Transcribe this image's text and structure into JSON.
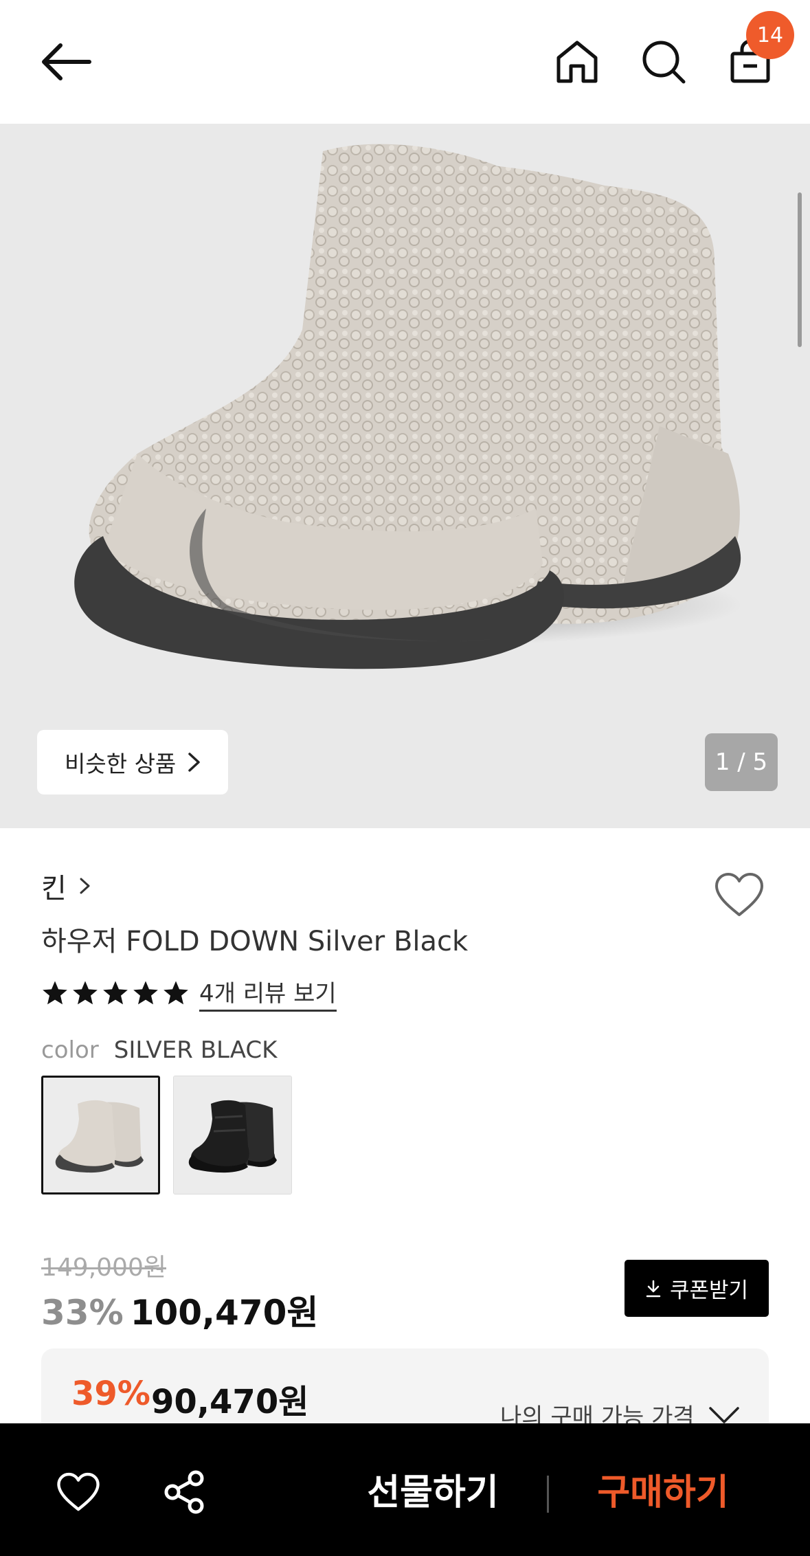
{
  "header": {
    "back_icon": "arrow-left-icon",
    "home_icon": "home-icon",
    "search_icon": "search-icon",
    "bag_icon": "shopping-bag-icon",
    "cart_count": "14",
    "badge_color": "#ef5b2b"
  },
  "gallery": {
    "similar_label": "비슷한 상품",
    "counter": "1 / 5"
  },
  "product": {
    "brand": "킨",
    "name": "하우저 FOLD DOWN Silver Black",
    "rating": 5,
    "review_link": "4개 리뷰 보기",
    "color_label": "color",
    "color_value": "SILVER BLACK",
    "swatches": [
      "silver-black",
      "black"
    ]
  },
  "pricing": {
    "original": "149,000원",
    "discount": "33%",
    "price": "100,470원",
    "coupon_label": "쿠폰받기",
    "my_discount": "39%",
    "my_price": "90,470원",
    "my_price_label": "나의 구매 가능 가격"
  },
  "bottom_bar": {
    "gift_label": "선물하기",
    "buy_label": "구매하기",
    "accent_color": "#ee5a2a"
  }
}
